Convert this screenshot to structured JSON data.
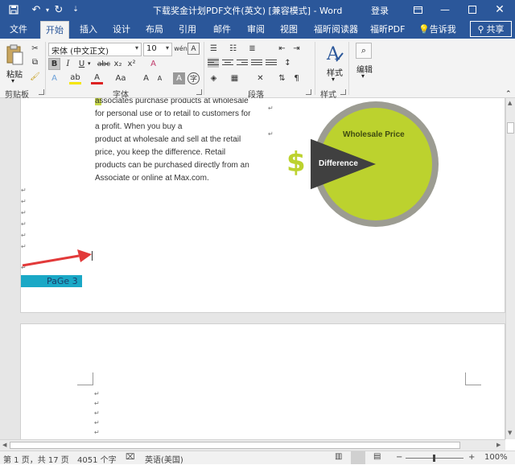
{
  "titlebar": {
    "title": "下载奖金计划PDF文件(英文) [兼容模式] - Word",
    "login": "登录",
    "qa_save_icon": "save-icon",
    "qa_undo_icon": "undo-icon",
    "qa_redo_icon": "redo-icon",
    "qa_customize_icon": "customize-icon"
  },
  "tabs": [
    {
      "label": "文件"
    },
    {
      "label": "开始"
    },
    {
      "label": "插入"
    },
    {
      "label": "设计"
    },
    {
      "label": "布局"
    },
    {
      "label": "引用"
    },
    {
      "label": "邮件"
    },
    {
      "label": "审阅"
    },
    {
      "label": "视图"
    },
    {
      "label": "福昕阅读器"
    },
    {
      "label": "福昕PDF"
    }
  ],
  "tell_me": "告诉我",
  "share": "共享",
  "ribbon": {
    "paste": "粘贴",
    "clipboard": "剪贴板",
    "font_group": "字体",
    "paragraph_group": "段落",
    "styles_group": "样式",
    "styles_button": "样式",
    "edit_button": "编辑",
    "font_name": "宋体 (中文正文)",
    "font_size": "10",
    "bold": "B",
    "italic": "I",
    "underline": "U",
    "strike": "abc",
    "subscript": "x₂",
    "superscript": "x²",
    "grow_font": "A",
    "shrink_font": "A",
    "change_case": "Aa",
    "clear_format": "A",
    "char_border": "A",
    "font_color": "A",
    "highlight": "ab",
    "text_effect": "A",
    "wen": "wén"
  },
  "document": {
    "lines": [
      "associates purchase products at wholesale",
      "for personal use or to retail to customers for",
      "a profit. When you buy  a",
      "product at wholesale and sell at the retail",
      "price, you keep the difference. Retail",
      "products can be purchased directly from an",
      "Associate or online at  Max.com."
    ],
    "page_label": "PaGe 3",
    "chart_label_wholesale": "Wholesale Price",
    "chart_label_difference": "Difference",
    "dollar": "$"
  },
  "status": {
    "page": "第 1 页，共 17 页",
    "words": "4051 个字",
    "language": "英语(美国)",
    "zoom": "100%"
  },
  "colors": {
    "word_blue": "#2b579a",
    "pie_green": "#bcd22e",
    "pie_dark": "#404040",
    "page_label_bg": "#1aa8c6",
    "arrow_red": "#e23a3a"
  }
}
